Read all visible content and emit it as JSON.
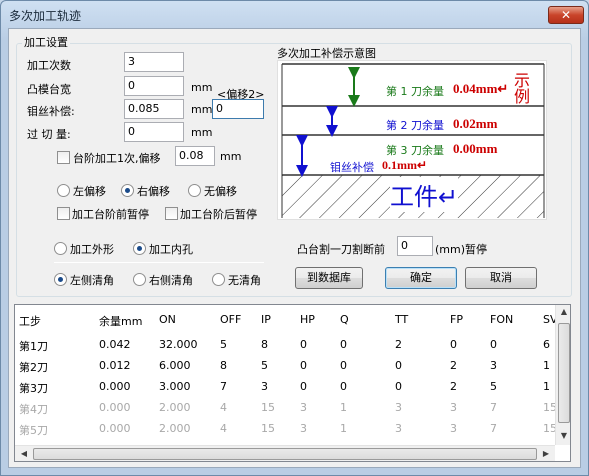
{
  "window": {
    "title": "多次加工轨迹",
    "close_glyph": "✕"
  },
  "settings_group": {
    "title": "加工设置"
  },
  "fields": {
    "count_label": "加工次数",
    "count_value": "3",
    "platform_label": "凸模台宽",
    "platform_value": "0",
    "platform_unit": "mm",
    "wire_label": "钼丝补偿:",
    "wire_value": "0.085",
    "wire_unit": "mm",
    "offset2_label": "<偏移2>",
    "offset2_value": "0",
    "overcut_label": "过 切 量:",
    "overcut_value": "0",
    "overcut_unit": "mm",
    "step_label": "台阶加工1次,偏移",
    "step_value": "0.08",
    "step_unit": "mm"
  },
  "offset_radios": [
    "左偏移",
    "右偏移",
    "无偏移"
  ],
  "pause_checks": {
    "before": "加工台阶前暂停",
    "after": "加工台阶后暂停"
  },
  "shape_radios": [
    "加工外形",
    "加工内孔"
  ],
  "corner_radios": [
    "左侧清角",
    "右侧清角",
    "无清角"
  ],
  "cut_pause": {
    "label": "凸台割一刀割断前",
    "value": "0",
    "unit": "(mm)暂停"
  },
  "buttons": {
    "database": "到数据库",
    "ok": "确定",
    "cancel": "取消"
  },
  "diagram": {
    "title": "多次加工补偿示意图",
    "line1_label": "第 1 刀余量",
    "line1_value": "0.04mm↵",
    "line2_label": "第 2 刀余量",
    "line2_value": "0.02mm",
    "line3_label": "第 3 刀余量",
    "line3_value": "0.00mm",
    "wire_label": "钼丝补偿",
    "wire_value": "0.1mm↵",
    "example": "示例",
    "workpiece": "工件↵"
  },
  "colors": {
    "green": "#1a7a1a",
    "blue": "#1010d0",
    "red": "#cc0000"
  },
  "table": {
    "headers": [
      "工步",
      "余量mm",
      "ON",
      "OFF",
      "IP",
      "HP",
      "Q",
      "TT",
      "FP",
      "FON",
      "SV"
    ],
    "rows": [
      [
        "第1刀",
        "0.042",
        "32.000",
        "5",
        "8",
        "0",
        "0",
        "2",
        "0",
        "0",
        "6"
      ],
      [
        "第2刀",
        "0.012",
        "6.000",
        "8",
        "5",
        "0",
        "0",
        "0",
        "2",
        "3",
        "1"
      ],
      [
        "第3刀",
        "0.000",
        "3.000",
        "7",
        "3",
        "0",
        "0",
        "0",
        "2",
        "5",
        "1"
      ],
      [
        "第4刀",
        "0.000",
        "2.000",
        "4",
        "15",
        "3",
        "1",
        "3",
        "3",
        "7",
        "15"
      ],
      [
        "第5刀",
        "0.000",
        "2.000",
        "4",
        "15",
        "3",
        "1",
        "3",
        "3",
        "7",
        "15"
      ]
    ]
  }
}
